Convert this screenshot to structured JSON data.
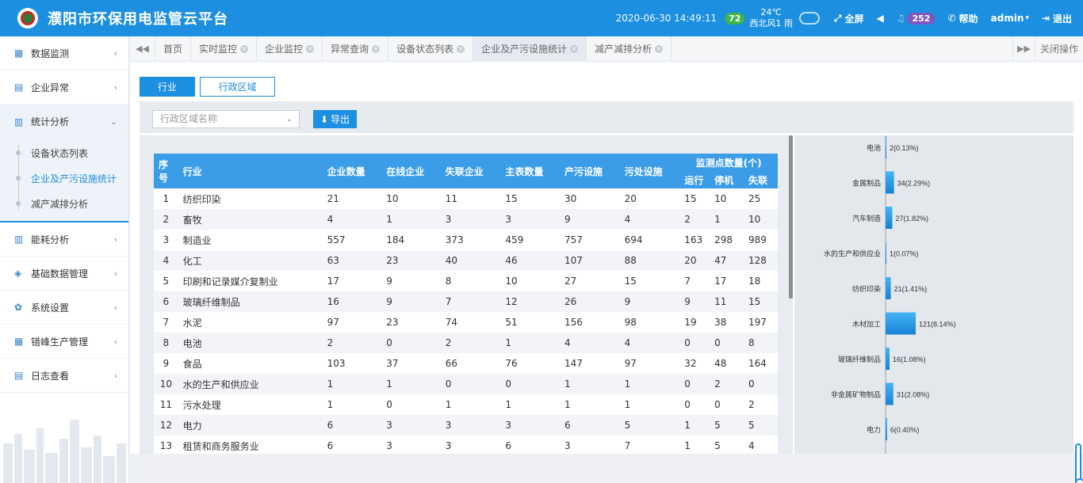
{
  "header": {
    "title": "濮阳市环保用电监管云平台",
    "datetime": "2020-06-30  14:49:11",
    "aqi": "72",
    "temperature": "24℃",
    "weather": "西北风1 雨",
    "fullscreen": "全屏",
    "notifications": "252",
    "help": "帮助",
    "user": "admin",
    "logout": "退出"
  },
  "sidebar": {
    "items": [
      {
        "label": "数据监测",
        "icon": "calendar-icon"
      },
      {
        "label": "企业异常",
        "icon": "doc-icon"
      },
      {
        "label": "统计分析",
        "icon": "bar-chart-icon"
      },
      {
        "label": "能耗分析",
        "icon": "bar-chart-icon"
      },
      {
        "label": "基础数据管理",
        "icon": "layers-icon"
      },
      {
        "label": "系统设置",
        "icon": "gear-icon"
      },
      {
        "label": "错峰生产管理",
        "icon": "calendar-icon"
      },
      {
        "label": "日志查看",
        "icon": "doc-icon"
      }
    ],
    "subitems": [
      "设备状态列表",
      "企业及产污设施统计",
      "减产减排分析"
    ]
  },
  "tabs": [
    "首页",
    "实时监控",
    "企业监控",
    "异常查询",
    "设备状态列表",
    "企业及产污设施统计",
    "减产减排分析"
  ],
  "close_all": "关闭操作",
  "toggle": {
    "industry": "行业",
    "region": "行政区域"
  },
  "filter": {
    "placeholder": "行政区域名称",
    "export": "导出"
  },
  "table": {
    "headers": {
      "no": "序号",
      "industry": "行业",
      "enterprises": "企业数量",
      "online": "在线企业",
      "offline": "失联企业",
      "main_meters": "主表数量",
      "polluting": "产污设施",
      "treatment": "污处设施",
      "points": "监测点数量(个)",
      "running": "运行",
      "stopped": "停机",
      "lost": "失联"
    },
    "rows": [
      [
        "1",
        "纺织印染",
        "21",
        "10",
        "11",
        "15",
        "30",
        "20",
        "15",
        "10",
        "25"
      ],
      [
        "2",
        "畜牧",
        "4",
        "1",
        "3",
        "3",
        "9",
        "4",
        "2",
        "1",
        "10"
      ],
      [
        "3",
        "制造业",
        "557",
        "184",
        "373",
        "459",
        "757",
        "694",
        "163",
        "298",
        "989"
      ],
      [
        "4",
        "化工",
        "63",
        "23",
        "40",
        "46",
        "107",
        "88",
        "20",
        "47",
        "128"
      ],
      [
        "5",
        "印刷和记录媒介复制业",
        "17",
        "9",
        "8",
        "10",
        "27",
        "15",
        "7",
        "17",
        "18"
      ],
      [
        "6",
        "玻璃纤维制品",
        "16",
        "9",
        "7",
        "12",
        "26",
        "9",
        "9",
        "11",
        "15"
      ],
      [
        "7",
        "水泥",
        "97",
        "23",
        "74",
        "51",
        "156",
        "98",
        "19",
        "38",
        "197"
      ],
      [
        "8",
        "电池",
        "2",
        "0",
        "2",
        "1",
        "4",
        "4",
        "0",
        "0",
        "8"
      ],
      [
        "9",
        "食品",
        "103",
        "37",
        "66",
        "76",
        "147",
        "97",
        "32",
        "48",
        "164"
      ],
      [
        "10",
        "水的生产和供应业",
        "1",
        "1",
        "0",
        "0",
        "1",
        "1",
        "0",
        "2",
        "0"
      ],
      [
        "11",
        "污水处理",
        "1",
        "0",
        "1",
        "1",
        "1",
        "1",
        "0",
        "0",
        "2"
      ],
      [
        "12",
        "电力",
        "6",
        "3",
        "3",
        "3",
        "6",
        "5",
        "1",
        "5",
        "5"
      ],
      [
        "13",
        "租赁和商务服务业",
        "6",
        "3",
        "3",
        "6",
        "3",
        "7",
        "1",
        "5",
        "4"
      ]
    ]
  },
  "chart_data": {
    "type": "bar",
    "orientation": "horizontal",
    "categories": [
      "电池",
      "金属制品",
      "汽车制造",
      "水的生产和供应业",
      "纺织印染",
      "木材加工",
      "玻璃纤维制品",
      "非金属矿物制品",
      "电力"
    ],
    "values": [
      2,
      34,
      27,
      1,
      21,
      121,
      16,
      31,
      6
    ],
    "labels": [
      "2(0.13%)",
      "34(2.29%)",
      "27(1.82%)",
      "1(0.07%)",
      "21(1.41%)",
      "121(8.14%)",
      "16(1.08%)",
      "31(2.08%)",
      "6(0.40%)"
    ],
    "bar_color": "#2a9be8"
  }
}
